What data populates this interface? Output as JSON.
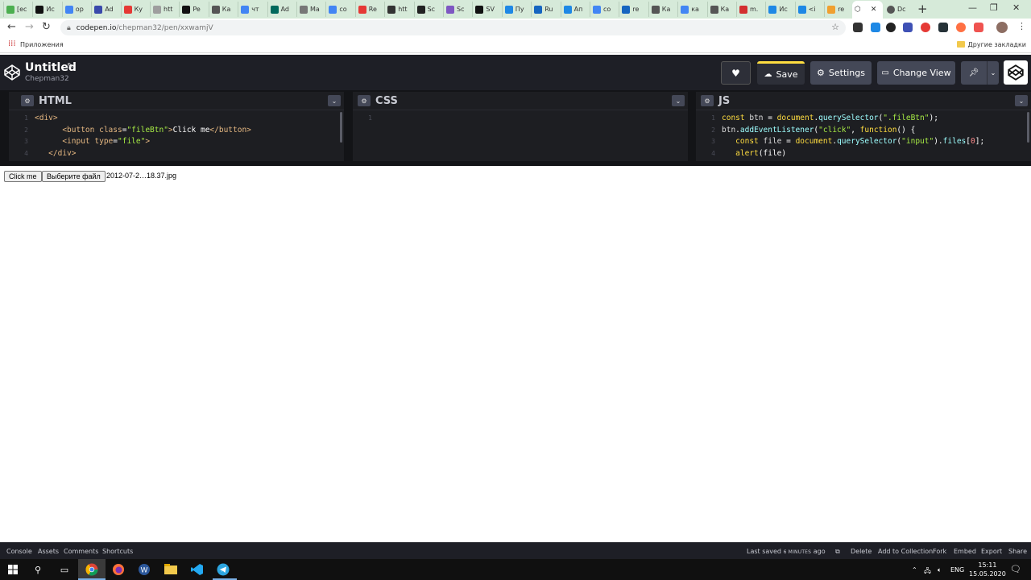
{
  "browser": {
    "tabs": [
      {
        "label": "[ес",
        "color": "#4caf50"
      },
      {
        "label": "Ис",
        "color": "#111111"
      },
      {
        "label": "ор",
        "color": "#4285f4"
      },
      {
        "label": "Ad",
        "color": "#3949ab"
      },
      {
        "label": "Ку",
        "color": "#e53935"
      },
      {
        "label": "htt",
        "color": "#9e9e9e"
      },
      {
        "label": "Pe",
        "color": "#111111"
      },
      {
        "label": "Ка",
        "color": "#555555"
      },
      {
        "label": "чт",
        "color": "#4285f4"
      },
      {
        "label": "Ad",
        "color": "#00695c"
      },
      {
        "label": "Ма",
        "color": "#777777"
      },
      {
        "label": "со",
        "color": "#4285f4"
      },
      {
        "label": "Re",
        "color": "#e53935"
      },
      {
        "label": "htt",
        "color": "#333333"
      },
      {
        "label": "Sc",
        "color": "#222222"
      },
      {
        "label": "Sc",
        "color": "#7e57c2"
      },
      {
        "label": "SV",
        "color": "#111111"
      },
      {
        "label": "Пу",
        "color": "#1e88e5"
      },
      {
        "label": "Ru",
        "color": "#1565c0"
      },
      {
        "label": "Ап",
        "color": "#1e88e5"
      },
      {
        "label": "со",
        "color": "#4285f4"
      },
      {
        "label": "re",
        "color": "#1565c0"
      },
      {
        "label": "Ка",
        "color": "#555555"
      },
      {
        "label": "ка",
        "color": "#4285f4"
      },
      {
        "label": "Ка",
        "color": "#555555"
      },
      {
        "label": "m.",
        "color": "#d32f2f"
      },
      {
        "label": "Ис",
        "color": "#1e88e5"
      },
      {
        "label": "<i",
        "color": "#1e88e5"
      },
      {
        "label": "re",
        "color": "#f0a030"
      }
    ],
    "active_tab_label": "",
    "extra_tab_label": "Dc",
    "url_host": "codepen.io",
    "url_path": "/chepman32/pen/xxwamjV",
    "bookmarks_apps": "Приложения",
    "bookmarks_other": "Другие закладки"
  },
  "codepen": {
    "title": "Untitled",
    "author": "Chepman32",
    "save_label": "Save",
    "settings_label": "Settings",
    "change_view_label": "Change View",
    "panels": {
      "html_title": "HTML",
      "css_title": "CSS",
      "js_title": "JS"
    },
    "html_code": [
      {
        "n": "1",
        "tokens": [
          [
            "t-tag",
            "<div>"
          ]
        ]
      },
      {
        "n": "2",
        "tokens": [
          [
            "t-plain",
            "      "
          ],
          [
            "t-tag",
            "<button "
          ],
          [
            "t-attr",
            "class"
          ],
          [
            "t-plain",
            "="
          ],
          [
            "t-str",
            "\"fileBtn\""
          ],
          [
            "t-tag",
            ">"
          ],
          [
            "t-plain",
            "Click me"
          ],
          [
            "t-tag",
            "</button>"
          ]
        ]
      },
      {
        "n": "3",
        "tokens": [
          [
            "t-plain",
            "      "
          ],
          [
            "t-tag",
            "<input "
          ],
          [
            "t-attr",
            "type"
          ],
          [
            "t-plain",
            "="
          ],
          [
            "t-str",
            "\"file\""
          ],
          [
            "t-tag",
            ">"
          ]
        ]
      },
      {
        "n": "4",
        "tokens": [
          [
            "t-plain",
            "   "
          ],
          [
            "t-tag",
            "</div>"
          ]
        ]
      }
    ],
    "css_code": [
      {
        "n": "1",
        "tokens": []
      }
    ],
    "js_code": [
      {
        "n": "1",
        "tokens": [
          [
            "t-kw",
            "const "
          ],
          [
            "t-var",
            "btn "
          ],
          [
            "t-plain",
            "= "
          ],
          [
            "t-kw",
            "document"
          ],
          [
            "t-plain",
            "."
          ],
          [
            "t-fn",
            "querySelector"
          ],
          [
            "t-plain",
            "("
          ],
          [
            "t-str",
            "\".fileBtn\""
          ],
          [
            "t-plain",
            ");"
          ]
        ]
      },
      {
        "n": "2",
        "tokens": [
          [
            "t-var",
            "btn"
          ],
          [
            "t-plain",
            "."
          ],
          [
            "t-fn",
            "addEventListener"
          ],
          [
            "t-plain",
            "("
          ],
          [
            "t-str",
            "\"click\""
          ],
          [
            "t-plain",
            ", "
          ],
          [
            "t-kw",
            "function"
          ],
          [
            "t-plain",
            "() {"
          ]
        ]
      },
      {
        "n": "3",
        "tokens": [
          [
            "t-plain",
            "   "
          ],
          [
            "t-kw",
            "const "
          ],
          [
            "t-var",
            "file "
          ],
          [
            "t-plain",
            "= "
          ],
          [
            "t-kw",
            "document"
          ],
          [
            "t-plain",
            "."
          ],
          [
            "t-fn",
            "querySelector"
          ],
          [
            "t-plain",
            "("
          ],
          [
            "t-str",
            "\"input\""
          ],
          [
            "t-plain",
            ")."
          ],
          [
            "t-fn",
            "files"
          ],
          [
            "t-plain",
            "["
          ],
          [
            "t-num",
            "0"
          ],
          [
            "t-plain",
            "];"
          ]
        ]
      },
      {
        "n": "4",
        "tokens": [
          [
            "t-plain",
            "   "
          ],
          [
            "t-kw",
            "alert"
          ],
          [
            "t-plain",
            "(file)"
          ]
        ]
      }
    ],
    "preview": {
      "click_button": "Click me",
      "file_button": "Выберите файл",
      "file_name": "2012-07-2…18.37.jpg"
    },
    "footer": {
      "left": [
        "Console",
        "Assets",
        "Comments",
        "Shortcuts"
      ],
      "saved_prefix": "Last saved ",
      "saved_time": "6 MINUTES",
      "saved_suffix": " ago",
      "right": [
        "Delete",
        "Add to Collection",
        "Fork",
        "Embed",
        "Export",
        "Share"
      ]
    }
  },
  "taskbar": {
    "lang": "ENG",
    "time": "15:11",
    "date": "15.05.2020"
  }
}
